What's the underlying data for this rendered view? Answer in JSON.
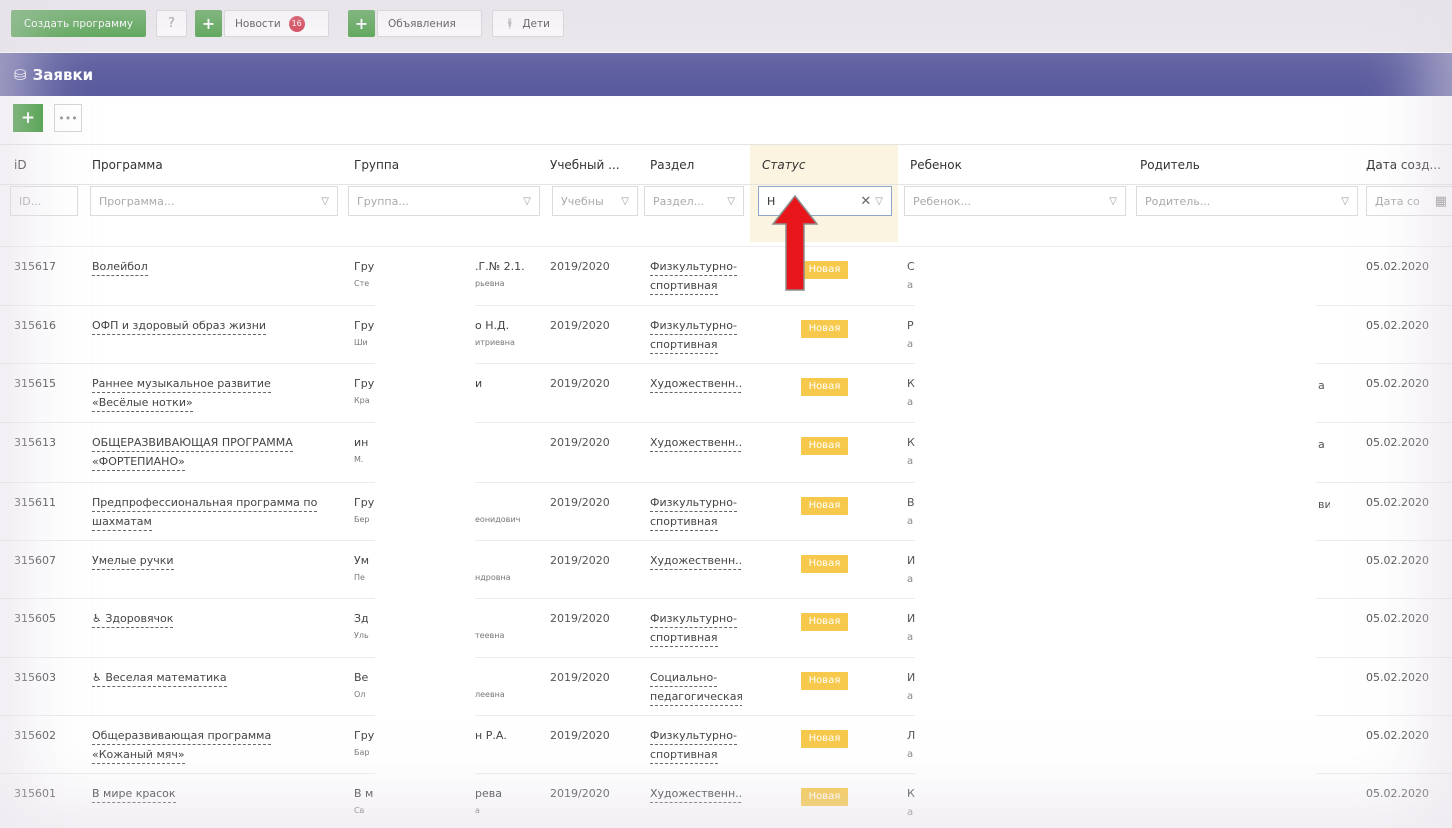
{
  "toolbar": {
    "create_label": "Создать программу",
    "help_label": "?",
    "plus_label": "+",
    "news_label": "Новости",
    "news_count": "16",
    "ads_label": "Объявления",
    "kids_label": "Дети"
  },
  "panel": {
    "title": "Заявки",
    "add_label": "+",
    "more_label": "•••"
  },
  "columns": [
    {
      "key": "id",
      "label": "iD",
      "filter": "ID..."
    },
    {
      "key": "program",
      "label": "Программа",
      "filter": "Программа..."
    },
    {
      "key": "group",
      "label": "Группа",
      "filter": "Группа..."
    },
    {
      "key": "year",
      "label": "Учебный ...",
      "filter": "Учебны"
    },
    {
      "key": "section",
      "label": "Раздел",
      "filter": "Раздел..."
    },
    {
      "key": "status",
      "label": "Статус",
      "filter": "Н"
    },
    {
      "key": "child",
      "label": "Ребенок",
      "filter": "Ребенок..."
    },
    {
      "key": "parent",
      "label": "Родитель",
      "filter": "Родитель..."
    },
    {
      "key": "date",
      "label": "Дата созд...",
      "filter": "Дата со"
    }
  ],
  "rows": [
    {
      "id": "315617",
      "program": [
        "Волейбол"
      ],
      "group": "Гру",
      "group_sub": "Сте",
      "group_r": ".Г.№ 2.1.",
      "group_r_sub": "рьевна",
      "year": "2019/2020",
      "section": [
        "Физкультурно-",
        "спортивная"
      ],
      "status": "Новая",
      "child": "С",
      "child_sub": "а",
      "parent": "",
      "date": "05.02.2020"
    },
    {
      "id": "315616",
      "program": [
        "ОФП и здоровый образ жизни"
      ],
      "group": "Гру",
      "group_sub": "Ши",
      "group_r": "о Н.Д.",
      "group_r_sub": "итриевна",
      "year": "2019/2020",
      "section": [
        "Физкультурно-",
        "спортивная"
      ],
      "status": "Новая",
      "child": "Р",
      "child_sub": "а",
      "parent": "",
      "date": "05.02.2020"
    },
    {
      "id": "315615",
      "program": [
        "Раннее музыкальное развитие",
        "«Весёлые нотки»"
      ],
      "group": "Гру",
      "group_sub": "Кра",
      "group_r": "и",
      "group_r_sub": "",
      "year": "2019/2020",
      "section": [
        "Художественн..."
      ],
      "status": "Новая",
      "child": "К",
      "child_sub": "а",
      "parent": "а",
      "date": "05.02.2020"
    },
    {
      "id": "315613",
      "program": [
        "ОБЩЕРАЗВИВАЮЩАЯ ПРОГРАММА",
        "«ФОРТЕПИАНО»"
      ],
      "group": "ин",
      "group_sub": "М.",
      "group_r": "",
      "group_r_sub": "",
      "year": "2019/2020",
      "section": [
        "Художественн..."
      ],
      "status": "Новая",
      "child": "К",
      "child_sub": "а",
      "parent": "а",
      "date": "05.02.2020"
    },
    {
      "id": "315611",
      "program": [
        "Предпрофессиональная программа по",
        "шахматам"
      ],
      "group": "Гру",
      "group_sub": "Бер",
      "group_r": "",
      "group_r_sub": "еонидович",
      "year": "2019/2020",
      "section": [
        "Физкультурно-",
        "спортивная"
      ],
      "status": "Новая",
      "child": "В",
      "child_sub": "а",
      "parent": "вич",
      "date": "05.02.2020"
    },
    {
      "id": "315607",
      "program": [
        "Умелые ручки"
      ],
      "group": "Ум",
      "group_sub": "Пе",
      "group_r": "",
      "group_r_sub": "ндровна",
      "year": "2019/2020",
      "section": [
        "Художественн..."
      ],
      "status": "Новая",
      "child": "И",
      "child_sub": "а",
      "parent": "",
      "date": "05.02.2020"
    },
    {
      "id": "315605",
      "program": [
        "♿ Здоровячок"
      ],
      "group": "Зд",
      "group_sub": "Уль",
      "group_r": "",
      "group_r_sub": "теевна",
      "year": "2019/2020",
      "section": [
        "Физкультурно-",
        "спортивная"
      ],
      "status": "Новая",
      "child": "И",
      "child_sub": "а",
      "parent": "",
      "date": "05.02.2020"
    },
    {
      "id": "315603",
      "program": [
        "♿ Веселая математика"
      ],
      "group": "Ве",
      "group_sub": "Ол",
      "group_r": "",
      "group_r_sub": "леевна",
      "year": "2019/2020",
      "section": [
        "Социально-",
        "педагогическая"
      ],
      "status": "Новая",
      "child": "И",
      "child_sub": "а",
      "parent": "",
      "date": "05.02.2020"
    },
    {
      "id": "315602",
      "program": [
        "Общеразвивающая программа",
        "«Кожаный мяч»"
      ],
      "group": "Гру",
      "group_sub": "Бар",
      "group_r": "н Р.А.",
      "group_r_sub": "",
      "year": "2019/2020",
      "section": [
        "Физкультурно-",
        "спортивная"
      ],
      "status": "Новая",
      "child": "Л",
      "child_sub": "а",
      "parent": "",
      "date": "05.02.2020"
    },
    {
      "id": "315601",
      "program": [
        "В мире красок"
      ],
      "group": "В м",
      "group_sub": "Св",
      "group_r": "рева",
      "group_r_sub": "а",
      "year": "2019/2020",
      "section": [
        "Художественн..."
      ],
      "status": "Новая",
      "child": "К",
      "child_sub": "а",
      "parent": "",
      "date": "05.02.2020"
    }
  ],
  "colors": {
    "accent_green": "#3f9a3a",
    "header_purple": "#5a5b9e",
    "status_yellow": "#f6c94c",
    "arrow_red": "#e8161b"
  }
}
